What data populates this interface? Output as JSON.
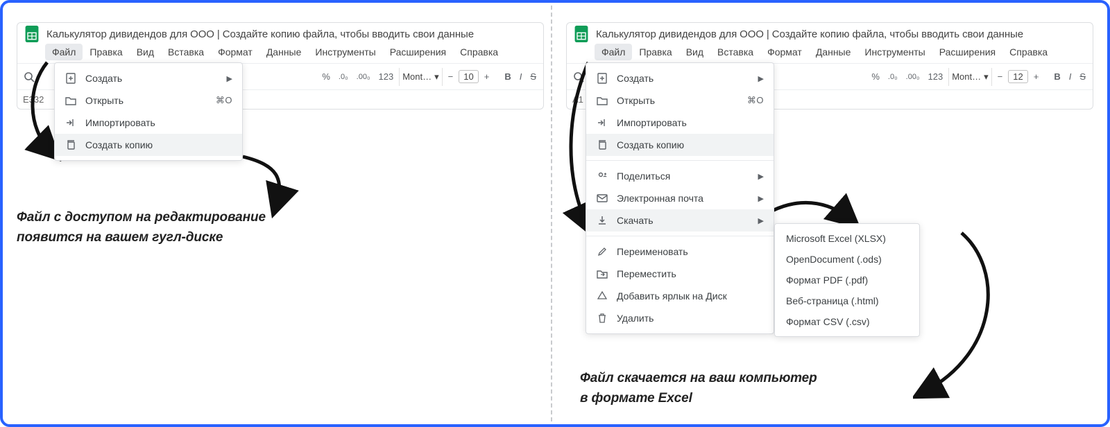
{
  "doc_title": "Калькулятор дивидендов для ООО | Создайте копию файла, чтобы вводить свои данные",
  "menubar": {
    "file": "Файл",
    "edit": "Правка",
    "view": "Вид",
    "insert": "Вставка",
    "format": "Формат",
    "data": "Данные",
    "tools": "Инструменты",
    "extensions": "Расширения",
    "help": "Справка"
  },
  "toolbar": {
    "percent": "%",
    "dec_dec": ".0₀",
    "inc_dec": ".00₀",
    "num123": "123",
    "font": "Mont…",
    "dropdown_glyph": "▾",
    "minus": "−",
    "plus": "+",
    "bold": "B",
    "italic": "I",
    "strike": "S"
  },
  "left": {
    "font_size": "10",
    "cell_ref": "E332",
    "menu": {
      "create": "Создать",
      "open": "Открыть",
      "open_shortcut": "⌘O",
      "import": "Импортировать",
      "make_copy": "Создать копию",
      "submenu_arrow": "▶"
    },
    "caption": "Файл с доступом на редактирование\nпоявится на вашем гугл-диске"
  },
  "right": {
    "font_size": "12",
    "cell_ref": "A1",
    "menu": {
      "create": "Создать",
      "open": "Открыть",
      "open_shortcut": "⌘O",
      "import": "Импортировать",
      "make_copy": "Создать копию",
      "share": "Поделиться",
      "email": "Электронная почта",
      "download": "Скачать",
      "rename": "Переименовать",
      "move": "Переместить",
      "add_shortcut": "Добавить ярлык на Диск",
      "delete": "Удалить",
      "submenu_arrow": "▶"
    },
    "download_submenu": {
      "xlsx": "Microsoft Excel (XLSX)",
      "ods": "OpenDocument (.ods)",
      "pdf": "Формат PDF (.pdf)",
      "html": "Веб-страница (.html)",
      "csv": "Формат CSV (.csv)"
    },
    "caption": "Файл скачается на ваш компьютер\nв формате Excel"
  }
}
